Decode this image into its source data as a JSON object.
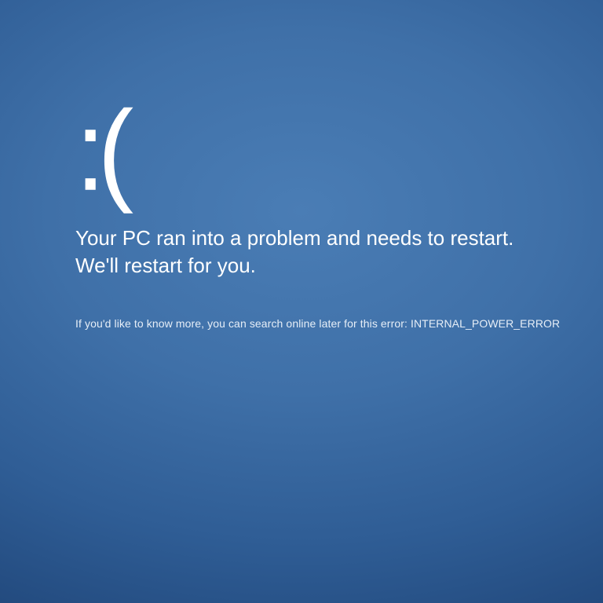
{
  "bsod": {
    "sad_face": ":(",
    "message_line1": "Your PC ran into a problem and needs to restart.",
    "message_line2": "We'll restart for you.",
    "details_prefix": "If you'd like to know more, you can search online later for this error: ",
    "error_code": "INTERNAL_POWER_ERROR"
  }
}
